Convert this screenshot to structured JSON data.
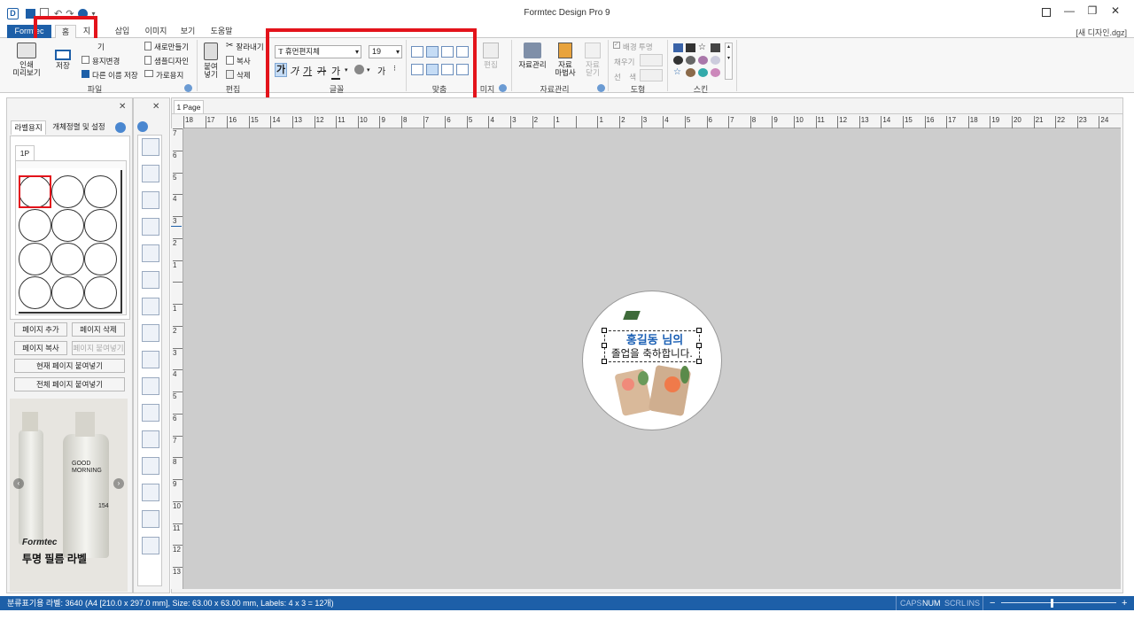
{
  "app": {
    "title": "Formtec Design Pro 9",
    "doc_name": "[새 디자인.dgz]"
  },
  "tabs": [
    {
      "label": "Formtec"
    },
    {
      "label": "홈"
    },
    {
      "label": "지"
    },
    {
      "label": "삽입"
    },
    {
      "label": "이미지"
    },
    {
      "label": "보기"
    },
    {
      "label": "도움말"
    }
  ],
  "ribbon": {
    "file": {
      "group": "파일",
      "print_preview": "인쇄\n미리보기",
      "save": "저장",
      "open": "기",
      "paper_change": "용지변경",
      "save_as": "다른 이름 저장",
      "new": "새로만들기",
      "sample": "샘플디자인",
      "landscape": "가로용지"
    },
    "edit": {
      "group": "편집",
      "paste": "붙여\n넣기",
      "cut": "잘라내기",
      "copy": "복사",
      "delete": "삭제"
    },
    "font": {
      "group": "글꼴",
      "name": "휴먼편지체",
      "size": "19",
      "style_buttons": [
        "가",
        "가",
        "가",
        "가",
        "가"
      ],
      "color_btn": "가"
    },
    "align": {
      "group": "맞춤"
    },
    "image": {
      "group": "미지",
      "edit": "편집"
    },
    "data": {
      "group": "자료관리",
      "manage": "자료관리",
      "wizard": "자료\n마법사",
      "close": "자료\n닫기"
    },
    "shape": {
      "group": "도형",
      "bg_transparent": "배경 투명",
      "fill": "채우기",
      "line": "선    색"
    },
    "skin": {
      "group": "스킨"
    }
  },
  "left_panel": {
    "tabs": [
      "라벨용지",
      "개체정렬 및 설정"
    ],
    "page_tab": "1P",
    "buttons": {
      "add_page": "페이지 추가",
      "delete_page": "페이지 삭제",
      "copy_page": "페이지 복사",
      "paste_page": "페이지 붙여넣기",
      "paste_current": "현재 페이지 붙여넣기",
      "paste_all": "전체 페이지 붙여넣기"
    },
    "ad": {
      "brand": "Formtec",
      "caption": "투명 필름 라벨",
      "bottle_text1": "GOOD",
      "bottle_text2": "MORNING",
      "bottle_num": "154"
    }
  },
  "canvas": {
    "page_tab": "1 Page",
    "ruler_h": [
      "18",
      "17",
      "16",
      "15",
      "14",
      "13",
      "12",
      "11",
      "10",
      "9",
      "8",
      "7",
      "6",
      "5",
      "4",
      "3",
      "2",
      "1",
      "",
      "1",
      "2",
      "3",
      "4",
      "5",
      "6",
      "7",
      "8",
      "9",
      "10",
      "11",
      "12",
      "13",
      "14",
      "15",
      "16",
      "17",
      "18",
      "19",
      "20",
      "21",
      "22",
      "23",
      "24"
    ],
    "ruler_v": [
      "7",
      "6",
      "5",
      "4",
      "3",
      "2",
      "1",
      "",
      "1",
      "2",
      "3",
      "4",
      "5",
      "6",
      "7",
      "8",
      "9",
      "10",
      "11",
      "12",
      "13"
    ],
    "label_text1": "홍길동 님의",
    "label_text2": "졸업을 축하합니다."
  },
  "statusbar": {
    "info": "분류표기용 라벨: 3640 (A4 [210.0 x 297.0 mm], Size: 63.00 x 63.00 mm,  Labels: 4 x 3 = 12개)",
    "caps": "CAPS",
    "num": "NUM",
    "scrl": "SCRL",
    "ins": "INS",
    "zoom_minus": "−",
    "zoom_plus": "+"
  },
  "colors": {
    "accent": "#1d5fa8",
    "highlight": "#e3131b",
    "canvas_bg": "#cdcdcd",
    "label_blue": "#1a5fb4"
  }
}
